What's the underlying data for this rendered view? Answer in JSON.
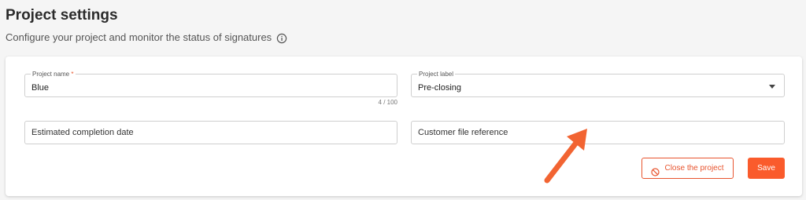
{
  "header": {
    "title": "Project settings",
    "subtitle": "Configure your project and monitor the status of signatures",
    "info_icon": "info-icon"
  },
  "form": {
    "project_name": {
      "label": "Project name",
      "required_mark": "*",
      "value": "Blue",
      "counter": "4 / 100"
    },
    "project_label": {
      "label": "Project label",
      "value": "Pre-closing",
      "icon": "chevron-down-icon"
    },
    "completion_date": {
      "placeholder": "Estimated completion date"
    },
    "file_reference": {
      "placeholder": "Customer file reference"
    }
  },
  "actions": {
    "close_label": "Close the project",
    "close_icon": "ban-icon",
    "save_label": "Save"
  },
  "colors": {
    "accent": "#fa5b2c",
    "background": "#f5f5f5",
    "card": "#ffffff"
  },
  "annotation": {
    "arrow_icon": "pointer-arrow-icon"
  }
}
